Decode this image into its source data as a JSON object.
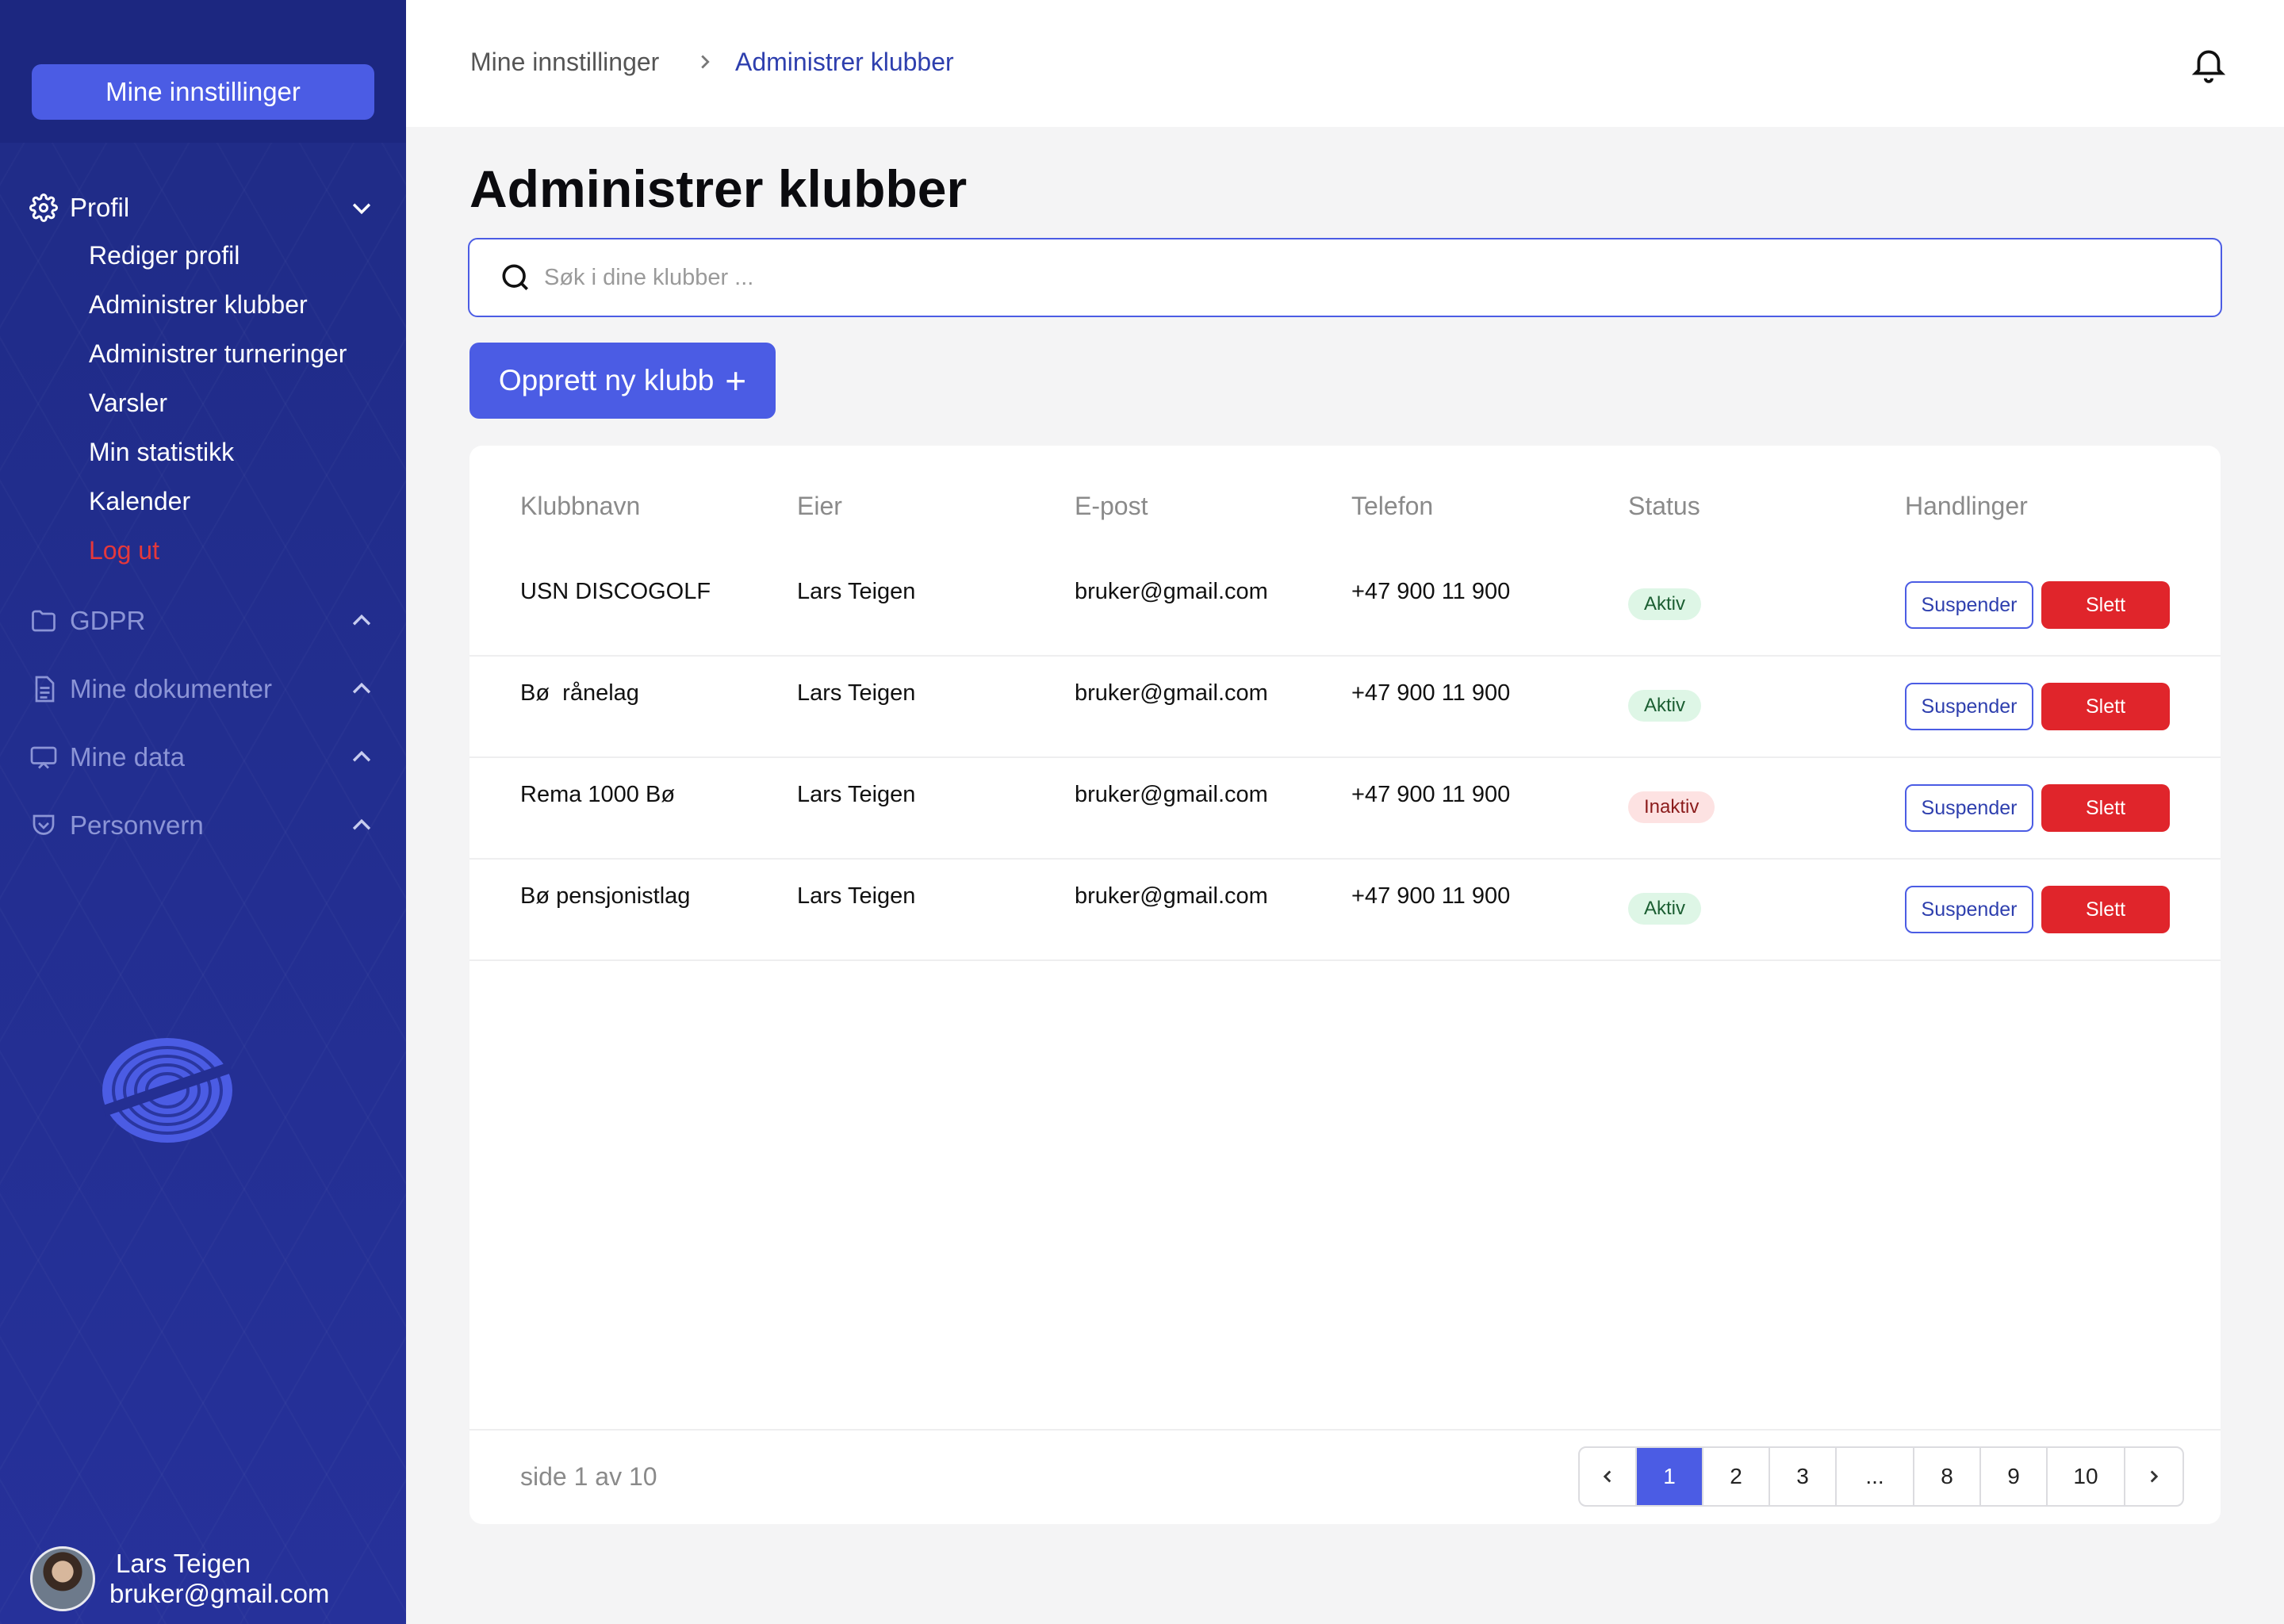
{
  "sidebar": {
    "settings_button": "Mine innstillinger",
    "groups": [
      {
        "label": "Profil",
        "icon": "gear-icon",
        "expanded": true
      },
      {
        "label": "GDPR",
        "icon": "folder-icon",
        "expanded": false
      },
      {
        "label": "Mine dokumenter",
        "icon": "document-icon",
        "expanded": false
      },
      {
        "label": "Mine data",
        "icon": "monitor-icon",
        "expanded": false
      },
      {
        "label": "Personvern",
        "icon": "shield-icon",
        "expanded": false
      }
    ],
    "profile_items": [
      "Rediger profil",
      "Administrer klubber",
      "Administrer turneringer",
      "Varsler",
      "Min statistikk",
      "Kalender"
    ],
    "logout": "Log ut",
    "user": {
      "name": "Lars Teigen",
      "email": "bruker@gmail.com"
    }
  },
  "breadcrumb": {
    "parent": "Mine innstillinger",
    "current": "Administrer klubber"
  },
  "page": {
    "title": "Administrer klubber"
  },
  "search": {
    "placeholder": "Søk i dine klubber ..."
  },
  "create_button": "Opprett ny klubb",
  "table": {
    "headers": [
      "Klubbnavn",
      "Eier",
      "E-post",
      "Telefon",
      "Status",
      "Handlinger"
    ],
    "rows": [
      {
        "name": "USN DISCOGOLF",
        "owner": "Lars Teigen",
        "email": "bruker@gmail.com",
        "phone": "+47 900 11 900",
        "status": "Aktiv",
        "suspend": "Suspender",
        "delete": "Slett"
      },
      {
        "name": "Bø  rånelag",
        "owner": "Lars Teigen",
        "email": "bruker@gmail.com",
        "phone": "+47 900 11 900",
        "status": "Aktiv",
        "suspend": "Suspender",
        "delete": "Slett"
      },
      {
        "name": "Rema 1000 Bø",
        "owner": "Lars Teigen",
        "email": "bruker@gmail.com",
        "phone": "+47 900 11 900",
        "status": "Inaktiv",
        "suspend": "Suspender",
        "delete": "Slett"
      },
      {
        "name": "Bø pensjonistlag",
        "owner": "Lars Teigen",
        "email": "bruker@gmail.com",
        "phone": "+47 900 11 900",
        "status": "Aktiv",
        "suspend": "Suspender",
        "delete": "Slett"
      }
    ]
  },
  "pagination": {
    "info": "side 1 av 10",
    "pages": [
      "1",
      "2",
      "3",
      "...",
      "8",
      "9",
      "10"
    ],
    "current": "1"
  },
  "colors": {
    "sidebar": "#222d8a",
    "accent": "#4b5ce4",
    "danger": "#e0252b",
    "logout": "#e5383b"
  }
}
